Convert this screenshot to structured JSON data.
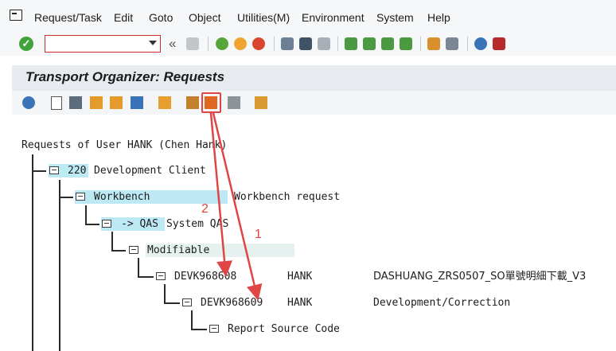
{
  "menubar": {
    "items": [
      "Request/Task",
      "Edit",
      "Goto",
      "Object",
      "Utilities(M)",
      "Environment",
      "System",
      "Help"
    ]
  },
  "toolbar": {
    "command_value": "",
    "nav_back_glyph": "«",
    "icons": [
      "ok-check-icon",
      "save-icon",
      "back-icon",
      "exit-icon",
      "cancel-icon",
      "print-icon",
      "find-icon",
      "find-next-icon",
      "first-page-icon",
      "prev-page-icon",
      "next-page-icon",
      "last-page-icon",
      "new-session-icon",
      "shortcut-icon",
      "help-icon",
      "customize-layout-icon"
    ]
  },
  "title": "Transport Organizer: Requests",
  "app_toolbar": {
    "icons": [
      "refresh-icon",
      "create-icon",
      "change-icon",
      "release-icon",
      "release-directly-icon",
      "delete-icon",
      "add-user-icon",
      "check-objects-icon",
      "transport-release-icon",
      "display-changes-icon",
      "overview-icon"
    ]
  },
  "tree": {
    "root": "Requests of User HANK (Chen Hank)",
    "client": {
      "num": "220",
      "label": "Development Client"
    },
    "workbench": {
      "label": "Workbench",
      "desc": "Workbench request"
    },
    "target": {
      "label": "-> QAS",
      "desc": "System QAS"
    },
    "status": "Modifiable",
    "requests": [
      {
        "id": "DEVK968608",
        "owner": "HANK",
        "desc": "DASHUANG_ZRS0507_SO單號明細下載_V3"
      },
      {
        "id": "DEVK968609",
        "owner": "HANK",
        "desc": "Development/Correction"
      }
    ],
    "child": "Report Source Code"
  },
  "annotations": {
    "one": "1",
    "two": "2"
  },
  "colors": {
    "highlight": "#bde9f4",
    "annotation_red": "#e04545",
    "title_bg": "#e7ebef"
  }
}
